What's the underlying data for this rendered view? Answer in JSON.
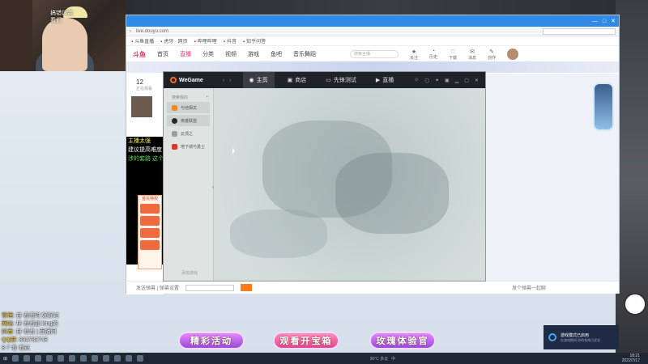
{
  "webcam": {
    "overlay_text_1": "搞错口我",
    "overlay_text_2": "看们"
  },
  "browser": {
    "url": "live.douyu.com",
    "bookmarks": [
      "斗鱼直播",
      "虎牙 · 网页",
      "哔哩哔哩",
      "抖音",
      "知乎问答"
    ],
    "window_controls": [
      "—",
      "□",
      "✕"
    ]
  },
  "site_nav": {
    "logo": "斗鱼",
    "items": [
      "首页",
      "直播",
      "分类",
      "视频",
      "游戏",
      "鱼吧",
      "音乐舞蹈"
    ],
    "active": "直播",
    "search_placeholder": "搜索主播",
    "tools": [
      {
        "icon": "★",
        "label": "关注"
      },
      {
        "icon": "◔",
        "label": "历史"
      },
      {
        "icon": "♡",
        "label": "下载"
      },
      {
        "icon": "✉",
        "label": "消息"
      },
      {
        "icon": "✎",
        "label": "创作"
      }
    ]
  },
  "stream": {
    "viewer_count": "12",
    "viewer_label": "正在观看",
    "chat_lines": [
      "主播太强",
      "建议提高难度",
      "涉的套路 这个"
    ],
    "gift_title": "首充特权",
    "footer_placeholder": "发个弹幕一起聊",
    "footer_left": "发送弹幕 | 弹幕设置"
  },
  "wegame": {
    "title": "WeGame",
    "tabs": [
      {
        "icon": "◉",
        "label": "主页"
      },
      {
        "icon": "▣",
        "label": "商店"
      },
      {
        "icon": "▭",
        "label": "先锋测试"
      },
      {
        "icon": "▶",
        "label": "直播"
      }
    ],
    "active_tab": "主页",
    "right_icons": [
      "☺",
      "▢",
      "✦",
      "▣",
      "▁",
      "▢",
      "✕"
    ],
    "sidebar_header": "搜索我的",
    "sidebar_items": [
      {
        "label": "与他相关",
        "color": "#ef8a2a",
        "active": true
      },
      {
        "label": "英雄联盟",
        "color": "#2a2a2a",
        "active": true
      },
      {
        "label": "云顶之",
        "color": "#9aa2a0",
        "active": false
      },
      {
        "label": "地下城与勇士",
        "color": "#d93a2a",
        "active": false
      }
    ],
    "sidebar_bottom": "添加游戏"
  },
  "overlay_chat": [
    {
      "name": "管理",
      "text": "排 看看时 好好过"
    },
    {
      "name": "网站",
      "text": "林 看看加  king的"
    },
    {
      "name": "抖音",
      "text": "排 看看 | 直播间"
    },
    {
      "name": "QQ群",
      "text": "832782748"
    },
    {
      "name": "",
      "text": "8-7 看 看过"
    }
  ],
  "big_buttons": [
    {
      "label": "精彩活动",
      "style": "purple"
    },
    {
      "label": "观看开宝箱",
      "style": "pink"
    },
    {
      "label": "玫瑰体验官",
      "style": "purple"
    }
  ],
  "toast": {
    "title": "游戏模式已启用",
    "body": "在游戏期间 你的系统已优化"
  },
  "taskbar": {
    "time": "18:21",
    "date": "2022/7/17",
    "temp": "36°C 多云",
    "lang": "中"
  },
  "colors": {
    "accent": "#e6356b",
    "browser_blue": "#2f8ae6",
    "wegame_bar": "#1f2226"
  }
}
